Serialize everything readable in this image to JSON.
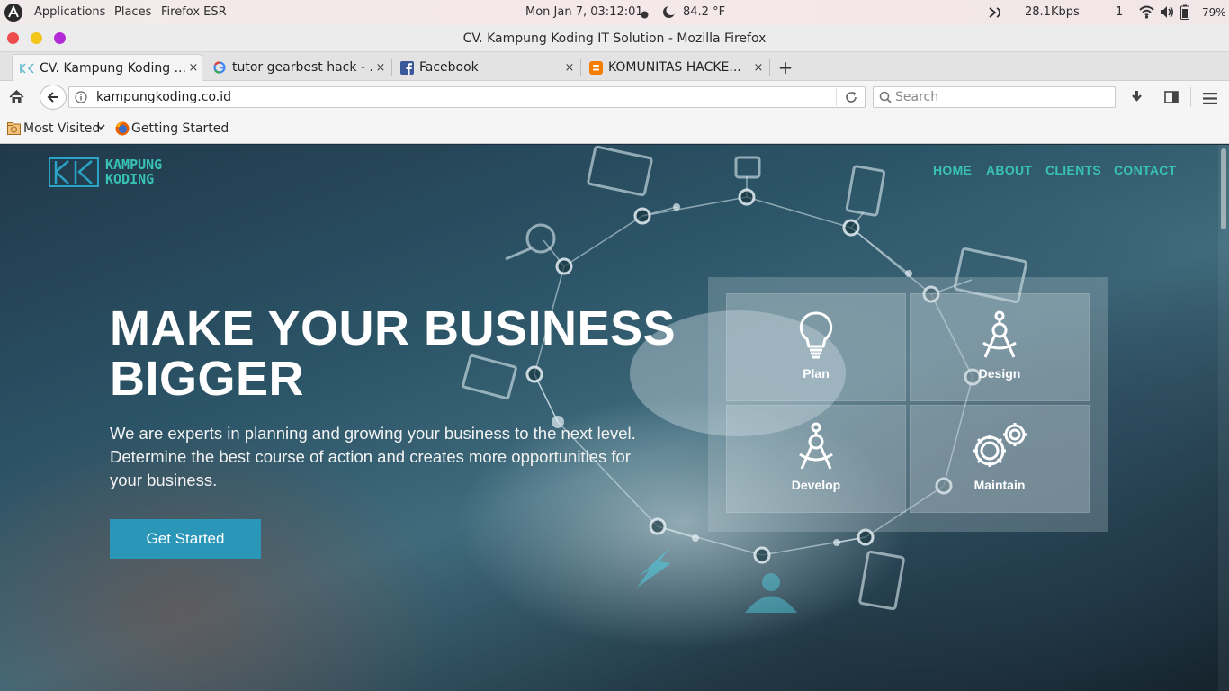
{
  "topbar": {
    "applications": "Applications",
    "places": "Places",
    "app_name": "Firefox ESR",
    "clock": "Mon Jan  7, 03:12:01",
    "temperature": "84.2 °F",
    "net_speed": "28.1Kbps",
    "workspace": "1",
    "battery": "79%"
  },
  "window": {
    "title": "CV. Kampung Koding IT Solution - Mozilla Firefox"
  },
  "tabs": [
    {
      "label": "CV. Kampung Koding ...",
      "close": "×"
    },
    {
      "label": "tutor gearbest hack - ...",
      "close": "×"
    },
    {
      "label": "Facebook",
      "close": "×"
    },
    {
      "label": "KOMUNITAS HACKE...",
      "close": "×"
    }
  ],
  "new_tab": "+",
  "navbar": {
    "url": "kampungkoding.co.id",
    "search_placeholder": "Search"
  },
  "bookmarks": {
    "most_visited": "Most Visited",
    "getting_started": "Getting Started"
  },
  "site": {
    "logo_line1": "KAMPUNG",
    "logo_line2": "KODING",
    "nav": [
      "HOME",
      "ABOUT",
      "CLIENTS",
      "CONTACT"
    ],
    "hero_title": "MAKE YOUR BUSINESS BIGGER",
    "hero_subtitle": "We are experts in planning and growing your business to the next level. Determine the best course of action and creates more opportunities for your business.",
    "cta": "Get Started",
    "services": [
      {
        "label": "Plan",
        "icon": "lightbulb-icon"
      },
      {
        "label": "Design",
        "icon": "compass-icon"
      },
      {
        "label": "Develop",
        "icon": "compass-icon"
      },
      {
        "label": "Maintain",
        "icon": "gears-icon"
      }
    ]
  },
  "colors": {
    "accent": "#38c2b1",
    "cta": "#2a96b8"
  }
}
